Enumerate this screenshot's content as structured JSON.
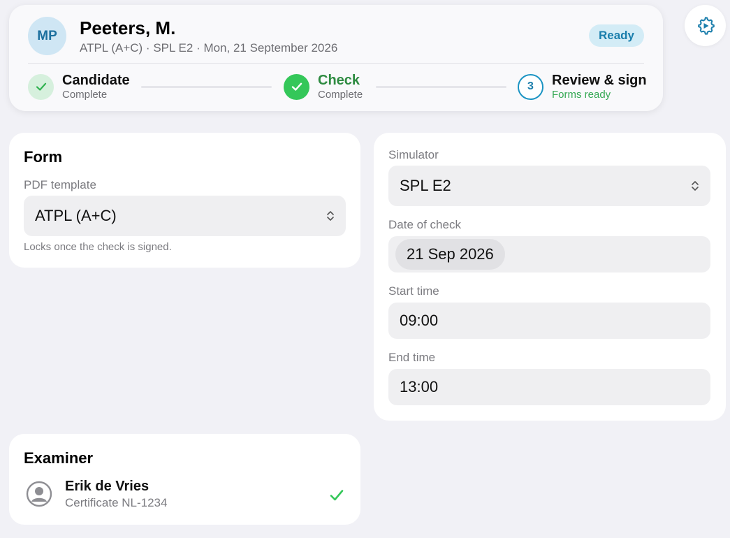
{
  "header": {
    "avatar_initials": "MP",
    "candidate_name": "Peeters, M.",
    "subtitle": "ATPL (A+C) · SPL E2 · Mon, 21 September 2026",
    "status": "Ready",
    "status_color": "#1a7eac",
    "steps": [
      {
        "title": "Candidate",
        "subtitle": "Complete",
        "state": "complete"
      },
      {
        "title": "Check",
        "subtitle": "Complete",
        "state": "complete"
      },
      {
        "number": "3",
        "title": "Review & sign",
        "subtitle": "Forms ready",
        "state": "current"
      }
    ]
  },
  "settings": {
    "icon": "gear-icon"
  },
  "form_card": {
    "title": "Form",
    "pdf_template_label": "PDF template",
    "pdf_template_value": "ATPL (A+C)",
    "hint": "Locks once the check is signed."
  },
  "details_card": {
    "simulator_label": "Simulator",
    "simulator_value": "SPL E2",
    "date_label": "Date of check",
    "date_value": "21 Sep 2026",
    "start_label": "Start time",
    "start_value": "09:00",
    "end_label": "End time",
    "end_value": "13:00"
  },
  "examiner_card": {
    "title": "Examiner",
    "name": "Erik de Vries",
    "certificate": "Certificate NL-1234",
    "verified_color": "#34c759"
  },
  "colors": {
    "accent_blue": "#1b94c3",
    "success_green": "#34c759",
    "background": "#f1f1f6"
  }
}
